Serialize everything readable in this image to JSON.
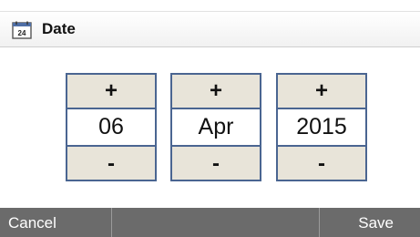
{
  "header": {
    "title": "Date",
    "icon": "calendar-icon",
    "icon_text": "24"
  },
  "spinners": [
    {
      "field": "day",
      "value": "06",
      "increment_label": "+",
      "decrement_label": "-"
    },
    {
      "field": "month",
      "value": "Apr",
      "increment_label": "+",
      "decrement_label": "-"
    },
    {
      "field": "year",
      "value": "2015",
      "increment_label": "+",
      "decrement_label": "-"
    }
  ],
  "footer": {
    "cancel_label": "Cancel",
    "save_label": "Save"
  },
  "colors": {
    "spinner_border": "#4a6591",
    "button_fill": "#e8e4d9",
    "footer_background": "#6b6b6b"
  }
}
